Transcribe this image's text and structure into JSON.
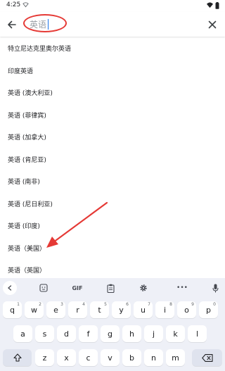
{
  "status_bar": {
    "time": "4:25"
  },
  "search": {
    "value": "英语"
  },
  "results": [
    "特立尼达克里奥尔英语",
    "印度英语",
    "英语 (澳大利亚)",
    "英语 (菲律宾)",
    "英语 (加拿大)",
    "英语 (肯尼亚)",
    "英语 (南非)",
    "英语 (尼日利亚)",
    "英语 (印度)",
    "英语（美国）",
    "英语（英国）"
  ],
  "keyboard": {
    "gif_label": "GIF",
    "more_label": "•••",
    "row1": [
      {
        "key": "q",
        "hint": "1"
      },
      {
        "key": "w",
        "hint": "2"
      },
      {
        "key": "e",
        "hint": "3"
      },
      {
        "key": "r",
        "hint": "4"
      },
      {
        "key": "t",
        "hint": "5"
      },
      {
        "key": "y",
        "hint": "6"
      },
      {
        "key": "u",
        "hint": "7"
      },
      {
        "key": "i",
        "hint": "8"
      },
      {
        "key": "o",
        "hint": "9"
      },
      {
        "key": "p",
        "hint": "0"
      }
    ],
    "row2": [
      "a",
      "s",
      "d",
      "f",
      "g",
      "h",
      "j",
      "k",
      "l"
    ],
    "row3": [
      "z",
      "x",
      "c",
      "v",
      "b",
      "n",
      "m"
    ]
  },
  "colors": {
    "annotation": "#e53935",
    "accent": "#1a73e8"
  }
}
